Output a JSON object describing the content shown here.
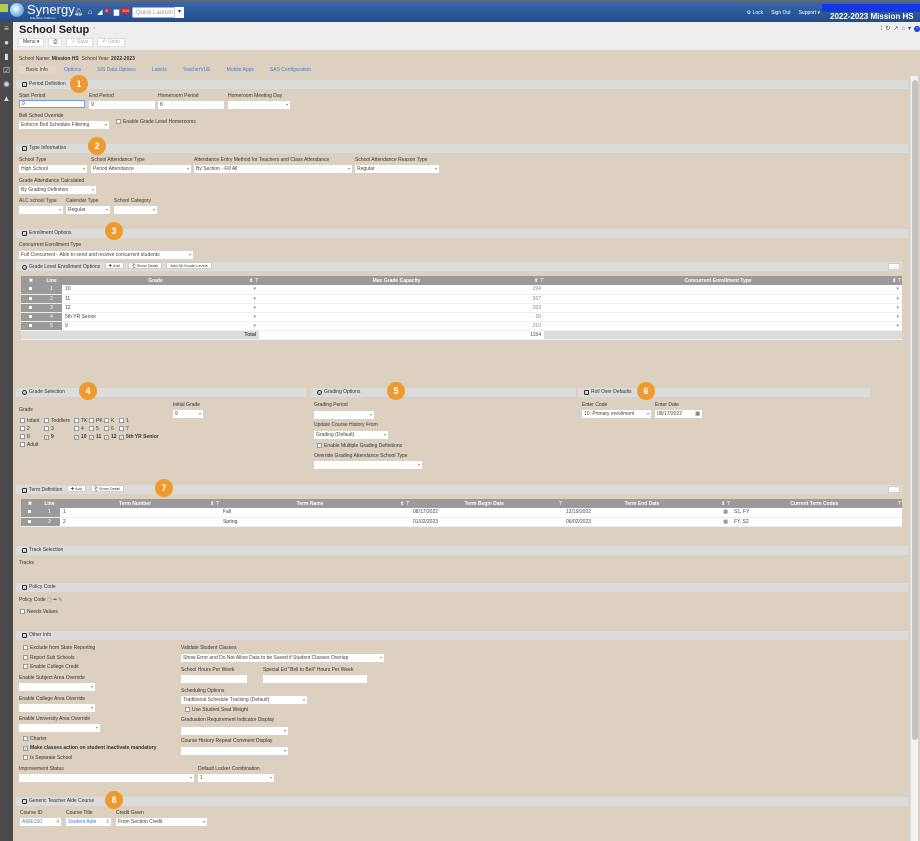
{
  "topbar": {
    "brand": "Synergy",
    "brand_sub": "Education Platform",
    "notifications": [
      {
        "icon": "bell-icon"
      },
      {
        "icon": "home-icon"
      },
      {
        "icon": "megaphone-icon",
        "badge": "8"
      },
      {
        "icon": "message-icon",
        "badge": "104"
      },
      {
        "icon": "apps-icon"
      }
    ],
    "quick_launch_placeholder": "Quick Launch",
    "lock": "Lock",
    "sign_out": "Sign Out",
    "support": "Support ▾",
    "year_school": "2022-2023 Mission HS"
  },
  "header": {
    "title": "School Setup",
    "menu": "Menu ▾",
    "save": "✓ Save",
    "undo": "↶ Undo"
  },
  "info": {
    "school_name_label": "School Name:",
    "school_name": "Mission HS",
    "school_year_label": "School Year:",
    "school_year": "2022-2023"
  },
  "tabs": [
    "Basic Info",
    "Options",
    "SIS Data Options",
    "Labels",
    "TeacherVUE",
    "Mobile Apps",
    "SAS Configuration"
  ],
  "period": {
    "title": "Period Definition",
    "num": "1",
    "start_label": "Start Period",
    "start": "0",
    "end_label": "End Period",
    "end": "9",
    "homeroom_label": "Homeroom Period",
    "homeroom": "8",
    "meeting_label": "Homeroom Meeting Day",
    "meeting": "",
    "bell_label": "Bell Sched Override",
    "bell": "Enforce Bell Schedule Filtering",
    "grade_homerooms": "Enable Grade Level Homerooms"
  },
  "type": {
    "title": "Type Information",
    "num": "2",
    "school_type_label": "School Type",
    "school_type": "High School",
    "att_type_label": "School Attendance Type",
    "att_type": "Period Attendance",
    "entry_label": "Attendance Entry Method for Teachers and Class Attendance",
    "entry": "By Section - Fill All",
    "reason_label": "School Attendance Reason Type",
    "reason": "Regular",
    "grade_att_label": "Grade Attendance Calculated",
    "grade_att": "By Grading Definition",
    "alc_label": "ALC school Type",
    "alc": "",
    "cal_label": "Calendar Type",
    "cal": "Regular",
    "cat_label": "School Category",
    "cat": ""
  },
  "enroll": {
    "title": "Enrollment Options",
    "num": "3",
    "conc_label": "Concurrent Enrollment Type",
    "conc": "Full Concurrent - Able to send and receive concurrent students",
    "grid_title": "Grade Level Enrollment Options",
    "add": "✚ Add",
    "show_detail": "Show Detail",
    "add_all": "Add All Grade Levels",
    "columns": [
      "✖",
      "Line",
      "Grade",
      "Max Grade Capacity",
      "Concurrent Enrollment Type"
    ],
    "rows": [
      {
        "line": "1",
        "grade": "10",
        "cap": "294",
        "type": ""
      },
      {
        "line": "2",
        "grade": "11",
        "cap": "267",
        "type": ""
      },
      {
        "line": "3",
        "grade": "12",
        "cap": "263",
        "type": ""
      },
      {
        "line": "4",
        "grade": "5th YR Senior",
        "cap": "20",
        "type": ""
      },
      {
        "line": "5",
        "grade": "9",
        "cap": "310",
        "type": ""
      }
    ],
    "total_label": "Total",
    "total": "1154"
  },
  "grade_sel": {
    "title": "Grade Selection",
    "num": "4",
    "grade_label": "Grade",
    "initial_label": "Initial Grade",
    "initial": "9",
    "rows": [
      [
        {
          "l": "Infant",
          "c": false
        },
        {
          "l": "Toddlers",
          "c": false
        },
        {
          "l": "TK",
          "c": false
        },
        {
          "l": "PK",
          "c": false
        },
        {
          "l": "K",
          "c": false
        },
        {
          "l": "1",
          "c": false
        }
      ],
      [
        {
          "l": "2",
          "c": false
        },
        {
          "l": "3",
          "c": false
        },
        {
          "l": "4",
          "c": false
        },
        {
          "l": "5",
          "c": false
        },
        {
          "l": "6",
          "c": false
        },
        {
          "l": "7",
          "c": false
        }
      ],
      [
        {
          "l": "8",
          "c": false
        },
        {
          "l": "9",
          "c": true
        },
        {
          "l": "10",
          "c": true
        },
        {
          "l": "11",
          "c": true
        },
        {
          "l": "12",
          "c": true
        },
        {
          "l": "5th YR Senior",
          "c": true
        }
      ],
      [
        {
          "l": "Adult",
          "c": false
        }
      ]
    ]
  },
  "grading": {
    "title": "Grading Options",
    "num": "5",
    "period_label": "Grading Period",
    "period": "",
    "update_label": "Update Course History From",
    "update": "Grading (Default)",
    "multi": "Enable Multiple Grading Definitions",
    "override_label": "Override Grading Attendance School Type",
    "override": ""
  },
  "rollover": {
    "title": "Roll Over Defaults",
    "num": "6",
    "code_label": "Enter Code",
    "code": "10: Primary enrollment",
    "date_label": "Enter Date",
    "date": "08/17/2022"
  },
  "term": {
    "title": "Term Definition",
    "num": "7",
    "add": "✚ Add",
    "show_detail": "Show Detail",
    "columns": [
      "✖",
      "Line",
      "Term Number",
      "Term Name",
      "Term Begin Date",
      "Term End Date",
      "Current Term Codes"
    ],
    "rows": [
      {
        "line": "1",
        "number": "1",
        "name": "Fall",
        "begin": "08/17/2022",
        "end": "12/19/2022",
        "codes": "S1, FY"
      },
      {
        "line": "2",
        "number": "2",
        "name": "Spring",
        "begin": "01/02/2023",
        "end": "06/02/2023",
        "codes": "FY, S2"
      }
    ]
  },
  "track": {
    "title": "Track Selection",
    "tracks": "Tracks"
  },
  "policy": {
    "title": "Policy Code",
    "label": "Policy Code",
    "needs": "Needs Values"
  },
  "other": {
    "title": "Other Info",
    "exclude": "Exclude from State Reporting",
    "sub": "Report Sub Schools",
    "college": "Enable College Credit",
    "subject_label": "Enable Subject Area Override",
    "college_area_label": "Enable College Area Override",
    "univ_label": "Enable University Area Override",
    "charter": "Charter",
    "make_classes": "Make classes action on student inactivate mandatory",
    "separate": "Is Separate School",
    "improvement_label": "Improvement Status",
    "locker_label": "Default Locker Combination",
    "locker": "1",
    "validate_label": "Validate Student Classes",
    "validate": "Show Error and Do Not Allow Data to be Saved if Student Classes Overlap",
    "hours_label": "School Hours Per Week",
    "sped_label": "Special Ed \"Bell to Bell\" Hours Per Week",
    "sched_label": "Scheduling Options",
    "sched": "Traditional Schedule Tracking (Default)",
    "seat": "Use Student Seat Weight",
    "grad_label": "Graduation Requirement Indicator Display",
    "repeat_label": "Course History Repeat Comment Display"
  },
  "aide": {
    "title": "Generic Teacher Aide Course",
    "num": "8",
    "id_label": "Course ID",
    "id": "AIDE150",
    "course_title_label": "Course Title",
    "course_title": "Student Aide",
    "credit_label": "Credit Given",
    "credit": "From Section Credit"
  }
}
